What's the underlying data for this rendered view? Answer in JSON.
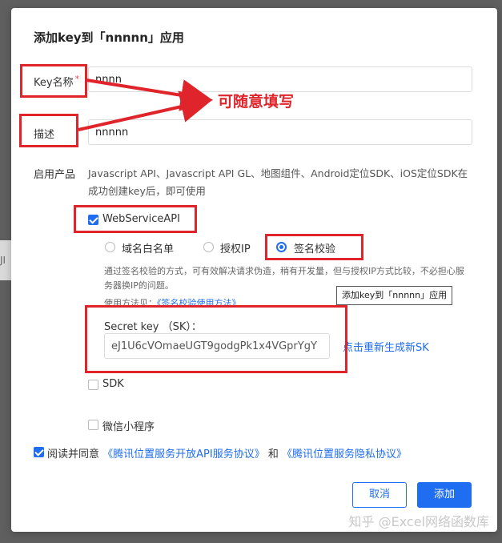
{
  "backdrop": {
    "text": "JI"
  },
  "dialog": {
    "title": "添加key到「nnnnn」应用",
    "key_name": {
      "label": "Key名称",
      "required_mark": "*",
      "value": "nnnn"
    },
    "description": {
      "label": "描述",
      "value": "nnnnn"
    },
    "products": {
      "label": "启用产品",
      "text": "Javascript API、Javascript API GL、地图组件、Android定位SDK、iOS定位SDK在成功创建key后，即可使用"
    },
    "webservice": {
      "label": "WebServiceAPI",
      "checked": true,
      "options": [
        "域名白名单",
        "授权IP",
        "签名校验"
      ],
      "selected": "签名校验",
      "note": "通过签名校验的方式，可有效解决请求伪造，稍有开发量，但与授权IP方式比较，不必担心服务器换IP的问题。",
      "usage_label": "使用方法见：",
      "usage_link": "《签名校验使用方法》",
      "secret_label": "Secret key （SK）：",
      "secret_value": "eJ1U6cVOmaeUGT9godgPk1x4VGprYgY",
      "regen_link": "点击重新生成新SK"
    },
    "sdk": {
      "label": "SDK",
      "checked": false
    },
    "miniprogram": {
      "label": "微信小程序",
      "checked": false
    },
    "agreement": {
      "checked": true,
      "prefix": "阅读并同意",
      "link1": "《腾讯位置服务开放API服务协议》",
      "middle": "和",
      "link2": "《腾讯位置服务隐私协议》"
    },
    "tooltip": "添加key到「nnnnn」应用",
    "buttons": {
      "cancel": "取消",
      "add": "添加"
    }
  },
  "annotation": {
    "text": "可随意填写",
    "color": "#e0242b"
  },
  "watermark": "知乎 @Excel网络函数库",
  "colors": {
    "primary": "#1f6df1",
    "annotation": "#e0242b"
  }
}
